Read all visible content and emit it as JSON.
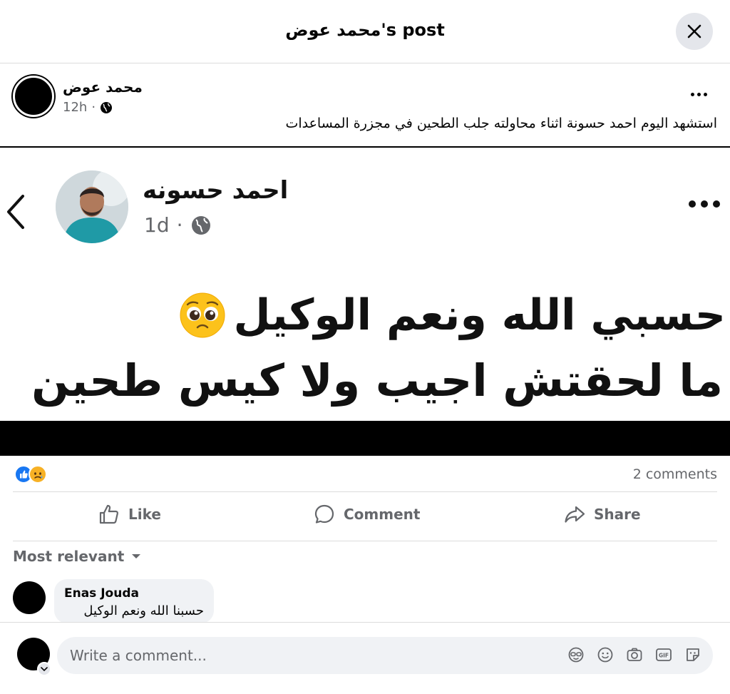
{
  "dialog": {
    "title": "محمد عوض's post",
    "close_icon": "close-icon"
  },
  "post": {
    "author": "محمد عوض",
    "time": "12h",
    "time_separator": "·",
    "privacy_icon": "globe-icon",
    "more_icon": "more-horizontal-icon",
    "caption": "استشهد اليوم احمد حسونة اثناء محاولته جلب الطحين في مجزرة المساعدات"
  },
  "shared_image": {
    "back_icon": "chevron-left-icon",
    "name": "احمد حسونه",
    "time": "1d",
    "time_separator": "·",
    "privacy_icon": "globe-icon",
    "more_icon": "more-horizontal-icon",
    "line1": "حسبي الله ونعم الوكيل",
    "line1_emoji": "pleading-face-emoji",
    "line2": "ما لحقتش اجيب ولا كيس طحين"
  },
  "reactions": {
    "icons": [
      "like-reaction-icon",
      "sad-reaction-icon"
    ],
    "comments_count": "2 comments"
  },
  "actions": {
    "like": "Like",
    "comment": "Comment",
    "share": "Share"
  },
  "comments": {
    "sort_label": "Most relevant",
    "items": [
      {
        "author": "Enas Jouda",
        "text": "حسبنا الله ونعم الوكيل"
      }
    ]
  },
  "composer": {
    "placeholder": "Write a comment...",
    "tools": [
      "avatar-sticker-icon",
      "emoji-icon",
      "camera-icon",
      "gif-icon",
      "sticker-icon"
    ]
  },
  "colors": {
    "accent_blue": "#1877f2",
    "secondary_text": "#65676b",
    "bubble_bg": "#f0f2f5"
  }
}
